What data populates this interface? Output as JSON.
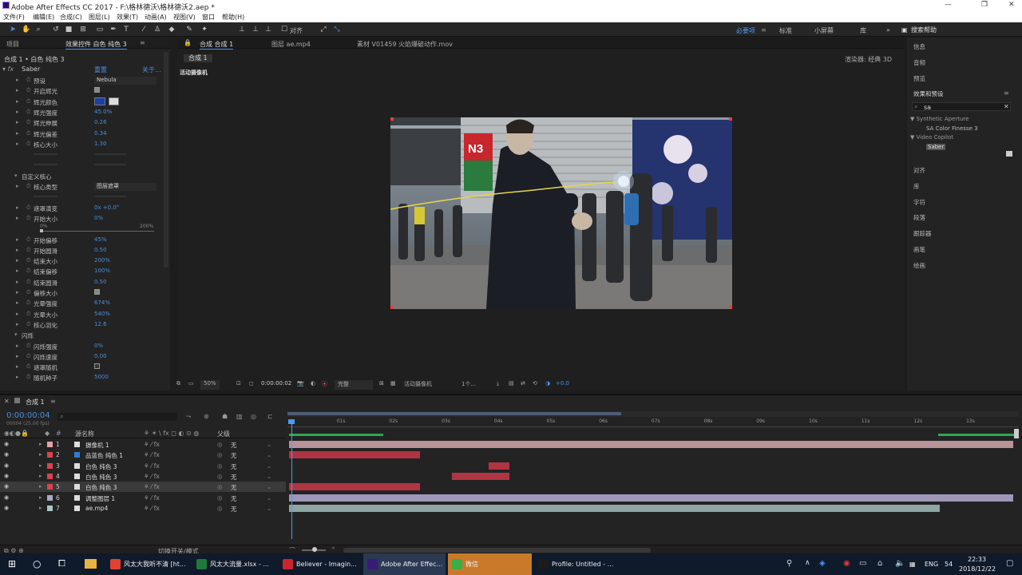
{
  "app": {
    "title": "Adobe After Effects CC 2017 - F:\\格林德沃\\格林德沃2.aep *",
    "window_controls": [
      "—",
      "❐",
      "✕"
    ]
  },
  "menu": [
    "文件(F)",
    "编辑(E)",
    "合成(C)",
    "图层(L)",
    "效果(T)",
    "动画(A)",
    "视图(V)",
    "窗口",
    "帮助(H)"
  ],
  "toolbar": {
    "align_label": "对齐",
    "workspaces": [
      "必要项",
      "标准",
      "小屏幕",
      "库"
    ],
    "active_workspace": "必要项",
    "search_help": "搜索帮助"
  },
  "left_panel": {
    "tabs": [
      "项目",
      "效果控件 白色 纯色 3"
    ],
    "breadcrumb": "合成 1 • 白色 纯色 3",
    "effect": {
      "name": "Saber",
      "reset": "重置",
      "about": "关于..."
    },
    "properties": [
      {
        "name": "预设",
        "value": "Nebula",
        "kind": "dropdown",
        "indent": 1
      },
      {
        "name": "开启辉光",
        "kind": "check",
        "indent": 1
      },
      {
        "name": "辉光颜色",
        "kind": "color",
        "indent": 1
      },
      {
        "name": "辉光强度",
        "value": "45.0%",
        "kind": "num",
        "indent": 1
      },
      {
        "name": "辉光伸展",
        "value": "0.26",
        "kind": "num",
        "indent": 1
      },
      {
        "name": "辉光偏差",
        "value": "0.34",
        "kind": "num",
        "indent": 1
      },
      {
        "name": "核心大小",
        "value": "1.30",
        "kind": "num",
        "indent": 1
      },
      {
        "name": "",
        "value": "",
        "kind": "dim",
        "indent": 1
      },
      {
        "name": "",
        "value": "",
        "kind": "dim",
        "indent": 1
      },
      {
        "name": "自定义核心",
        "kind": "group",
        "indent": 0
      },
      {
        "name": "核心类型",
        "value": "图层遮罩",
        "kind": "dropdown",
        "indent": 1
      },
      {
        "name": "",
        "kind": "dim",
        "indent": 1
      },
      {
        "name": "遮罩演变",
        "value": "0x +0.0°",
        "kind": "num",
        "indent": 1
      },
      {
        "name": "开始大小",
        "value": "0%",
        "kind": "num",
        "indent": 1
      },
      {
        "name": "slider",
        "kind": "slider",
        "min": "0%",
        "max": "200%"
      },
      {
        "name": "开始偏移",
        "value": "45%",
        "kind": "num",
        "indent": 1
      },
      {
        "name": "开始圆滑",
        "value": "0.50",
        "kind": "num",
        "indent": 1
      },
      {
        "name": "结束大小",
        "value": "200%",
        "kind": "num",
        "indent": 1
      },
      {
        "name": "结束偏移",
        "value": "100%",
        "kind": "num",
        "indent": 1
      },
      {
        "name": "结束圆滑",
        "value": "0.50",
        "kind": "num",
        "indent": 1
      },
      {
        "name": "偏移大小",
        "kind": "check",
        "indent": 1
      },
      {
        "name": "光晕强度",
        "value": "674%",
        "kind": "num",
        "indent": 1
      },
      {
        "name": "光晕大小",
        "value": "540%",
        "kind": "num",
        "indent": 1
      },
      {
        "name": "核心羽化",
        "value": "12.6",
        "kind": "num",
        "indent": 1
      },
      {
        "name": "闪烁",
        "kind": "group",
        "indent": 0
      },
      {
        "name": "闪烁强度",
        "value": "0%",
        "kind": "num",
        "indent": 1
      },
      {
        "name": "闪烁速度",
        "value": "0.00",
        "kind": "num",
        "indent": 1
      },
      {
        "name": "遮罩随机",
        "kind": "checkoff",
        "indent": 1
      },
      {
        "name": "随机种子",
        "value": "5000",
        "kind": "num",
        "indent": 1
      }
    ]
  },
  "viewer": {
    "tabs": [
      "合成 合成 1",
      "图层 ae.mp4",
      "素材 V01459 火焰爆破动作.mov"
    ],
    "sub_tab": "合成 1",
    "renderer": "渲染器:  经典 3D",
    "camera_label": "活动摄像机",
    "sign": "N3",
    "bottom": {
      "zoom": "50%",
      "timecode": "0:00:00:02",
      "quality": "完整",
      "camera": "活动摄像机",
      "views": "1个...",
      "exposure": "+0.0"
    }
  },
  "right_panel": {
    "items_top": [
      "信息",
      "音频",
      "预览"
    ],
    "effects_title": "效果和预设",
    "search_value": "sa",
    "tree": [
      {
        "text": "▼ Synthetic Aperture",
        "level": 0
      },
      {
        "text": "SA Color Finesse 3",
        "level": 1
      },
      {
        "text": "▼ Video Copilot",
        "level": 0
      },
      {
        "text": "Saber",
        "level": 1,
        "selected": true
      }
    ],
    "items_bottom": [
      "对齐",
      "库",
      "字符",
      "段落",
      "跟踪器",
      "画笔",
      "绘画"
    ]
  },
  "timeline": {
    "tab": "合成 1",
    "timecode": "0:00:00:04",
    "sub_timecode": "00004 (25.00 fps)",
    "headers": {
      "source": "源名称",
      "parent": "父级"
    },
    "ruler": [
      "0s",
      "01s",
      "02s",
      "03s",
      "04s",
      "05s",
      "06s",
      "07s",
      "08s",
      "09s",
      "10s",
      "11s",
      "12s",
      "13s"
    ],
    "layers": [
      {
        "num": "1",
        "name": "摄像机 1",
        "color": "#e6a2a8",
        "parent": "无",
        "selected": false,
        "bar_color": "#b9939a",
        "bar_start_s": 0,
        "bar_end_s": 13.8
      },
      {
        "num": "2",
        "name": "品蓝色 纯色 1",
        "color": "#d9444e",
        "parent": "无",
        "selected": false,
        "bar_color": "#b03543",
        "bar_start_s": 0,
        "bar_end_s": 2.5
      },
      {
        "num": "3",
        "name": "白色 纯色 3",
        "color": "#d9444e",
        "parent": "无",
        "selected": false,
        "bar_color": "#b03543",
        "bar_start_s": 3.8,
        "bar_end_s": 4.2
      },
      {
        "num": "4",
        "name": "白色 纯色 3",
        "color": "#d9444e",
        "parent": "无",
        "selected": false,
        "bar_color": "#b03543",
        "bar_start_s": 3.1,
        "bar_end_s": 4.2
      },
      {
        "num": "5",
        "name": "白色 纯色 3",
        "color": "#d9444e",
        "parent": "无",
        "selected": true,
        "bar_color": "#b03543",
        "bar_start_s": 0,
        "bar_end_s": 2.5
      },
      {
        "num": "6",
        "name": "调整图层 1",
        "color": "#a9a9c8",
        "parent": "无",
        "selected": false,
        "bar_color": "#9e97b8",
        "bar_start_s": 0,
        "bar_end_s": 13.8
      },
      {
        "num": "7",
        "name": "ae.mp4",
        "color": "#a7c7c3",
        "parent": "无",
        "selected": false,
        "bar_color": "#8fa6a3",
        "bar_start_s": 0,
        "bar_end_s": 12.4
      }
    ],
    "footer": "切换开关/模式"
  },
  "taskbar": {
    "apps": [
      {
        "label": "风太大我听不清 [ht...",
        "color": "#e34133",
        "active": false
      },
      {
        "label": "风太大流量.xlsx - ...",
        "color": "#1f7a3a",
        "active": false
      },
      {
        "label": "Believer - Imagin...",
        "color": "#c9252c",
        "active": false
      },
      {
        "label": "Adobe After Effec...",
        "color": "#3a1a78",
        "active": true
      },
      {
        "label": "微信",
        "color": "#35b046",
        "active": false
      },
      {
        "label": "Profile: Untitled - ...",
        "color": "#1b1b1b",
        "active": false
      }
    ],
    "lang": "ENG",
    "badge": "54",
    "time": "22:33",
    "date": "2018/12/22"
  }
}
